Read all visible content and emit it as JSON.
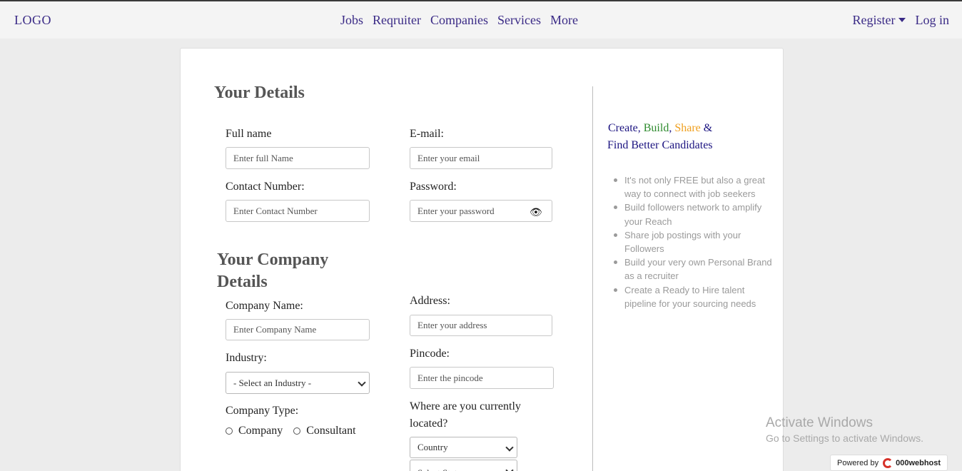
{
  "nav": {
    "logo": "LOGO",
    "links": [
      "Jobs",
      "Reqruiter",
      "Companies",
      "Services",
      "More"
    ],
    "register": "Register",
    "login": "Log in"
  },
  "form": {
    "details_title": "Your Details",
    "full_name": {
      "label": "Full name",
      "placeholder": "Enter full Name"
    },
    "email": {
      "label": "E-mail:",
      "placeholder": "Enter your email"
    },
    "contact": {
      "label": "Contact Number:",
      "placeholder": "Enter Contact Number"
    },
    "password": {
      "label": "Password:",
      "placeholder": "Enter your password"
    },
    "company_title_line1": "Your Company",
    "company_title_line2": "Details",
    "company_name": {
      "label": "Company Name:",
      "placeholder": "Enter Company Name"
    },
    "address": {
      "label": "Address:",
      "placeholder": "Enter your address"
    },
    "industry": {
      "label": "Industry:",
      "selected": "- Select an Industry -"
    },
    "pincode": {
      "label": "Pincode:",
      "placeholder": "Enter the pincode"
    },
    "company_type": {
      "label": "Company Type:",
      "options": [
        "Company",
        "Consultant"
      ]
    },
    "location": {
      "label_line1": "Where are you currently",
      "label_line2": "located?",
      "country": "Country",
      "state": "Select State"
    }
  },
  "promo": {
    "words": [
      "Create",
      "Build",
      "Share"
    ],
    "amp": "&",
    "line2": "Find Better Candidates",
    "benefits": [
      "It's not only FREE but also a great way to connect with job seekers",
      "Build followers network to amplify your Reach",
      "Share job postings with your Followers",
      "Build your very own Personal Brand as a recruiter",
      "Create a Ready to Hire talent pipeline for your sourcing needs"
    ]
  },
  "overlay": {
    "activate_title": "Activate Windows",
    "activate_sub": "Go to Settings to activate Windows.",
    "powered_by": "Powered by",
    "host_brand": "000webhost"
  },
  "colors": {
    "nav_link": "#3a2a86",
    "heading": "#555555",
    "promo_blue": "#1b1380",
    "promo_green": "#2e8b2e",
    "promo_orange": "#f0a020"
  },
  "icons": [
    "eye-icon",
    "chevron-down-icon",
    "caret-down-icon"
  ]
}
